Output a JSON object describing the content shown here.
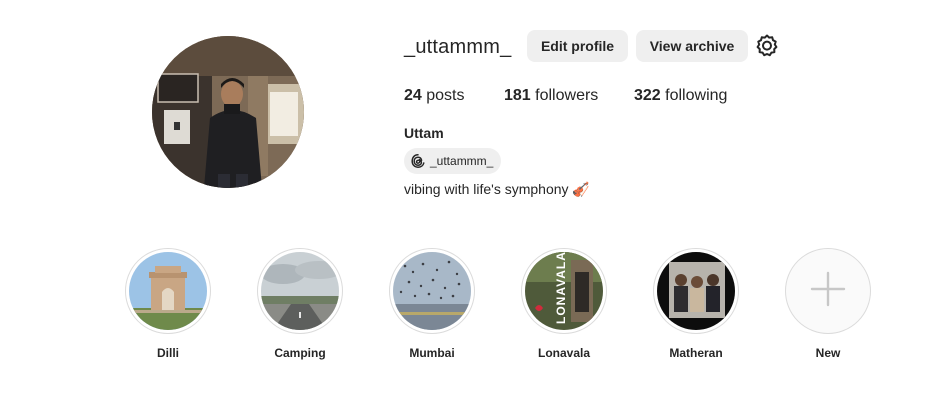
{
  "profile": {
    "username": "_uttammm_",
    "edit_profile_label": "Edit profile",
    "view_archive_label": "View archive",
    "posts_count": "24",
    "posts_label": "posts",
    "followers_count": "181",
    "followers_label": "followers",
    "following_count": "322",
    "following_label": "following",
    "full_name": "Uttam",
    "threads_handle": "_uttammm_",
    "bio": "vibing with life's symphony 🎻"
  },
  "highlights": [
    {
      "label": "Dilli"
    },
    {
      "label": "Camping"
    },
    {
      "label": "Mumbai"
    },
    {
      "label": "Lonavala"
    },
    {
      "label": "Matheran"
    },
    {
      "label": "New"
    }
  ],
  "photo_text": {
    "lonavala_overlay": "LONAVALA"
  },
  "icons": {
    "settings": "gear-icon",
    "threads": "threads-icon",
    "new_highlight": "plus-icon"
  },
  "colors": {
    "button_bg": "#efefef",
    "text": "#262626",
    "ring": "#dbdbdb"
  }
}
